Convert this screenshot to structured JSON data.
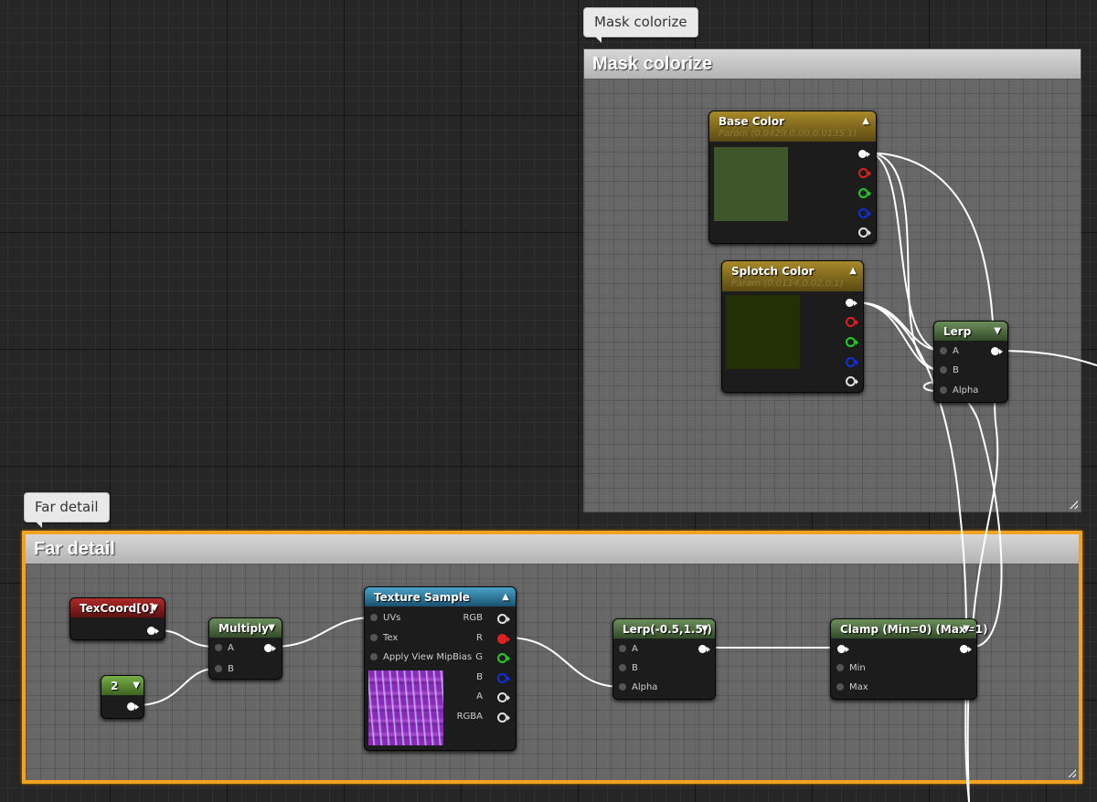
{
  "comments": {
    "mask_colorize": {
      "tag": "Mask colorize",
      "title": "Mask colorize"
    },
    "far_detail": {
      "tag": "Far detail",
      "title": "Far detail"
    }
  },
  "nodes": {
    "base_color": {
      "title": "Base Color",
      "subtitle": "Param (0.0429,0.00,0.0135,1)",
      "swatch": "#3f562b"
    },
    "splotch_color": {
      "title": "Splotch Color",
      "subtitle": "Param (0.0114,0.02,0,1)",
      "swatch": "#233003"
    },
    "lerp": {
      "title": "Lerp",
      "pins": {
        "a": "A",
        "b": "B",
        "alpha": "Alpha"
      }
    },
    "texcoord": {
      "title": "TexCoord[0]"
    },
    "constant": {
      "title": "2"
    },
    "multiply": {
      "title": "Multiply",
      "pins": {
        "a": "A",
        "b": "B"
      }
    },
    "texture_sample": {
      "title": "Texture Sample",
      "inputs": {
        "uvs": "UVs",
        "tex": "Tex",
        "mip": "Apply View MipBias"
      },
      "outputs": {
        "rgb": "RGB",
        "r": "R",
        "g": "G",
        "b": "B",
        "a": "A",
        "rgba": "RGBA"
      }
    },
    "lerp_range": {
      "title": "Lerp(-0.5,1.5,)",
      "pins": {
        "a": "A",
        "b": "B",
        "alpha": "Alpha"
      }
    },
    "clamp": {
      "title": "Clamp (Min=0) (Max=1)",
      "pins": {
        "min": "Min",
        "max": "Max"
      }
    }
  },
  "colors": {
    "selection": "#f2a21e",
    "param_header": "#a8892a",
    "math_header": "#6c8f5c",
    "texcoord_header": "#b02a2a",
    "texture_header": "#4aa3c8",
    "constant_header": "#78b048"
  }
}
